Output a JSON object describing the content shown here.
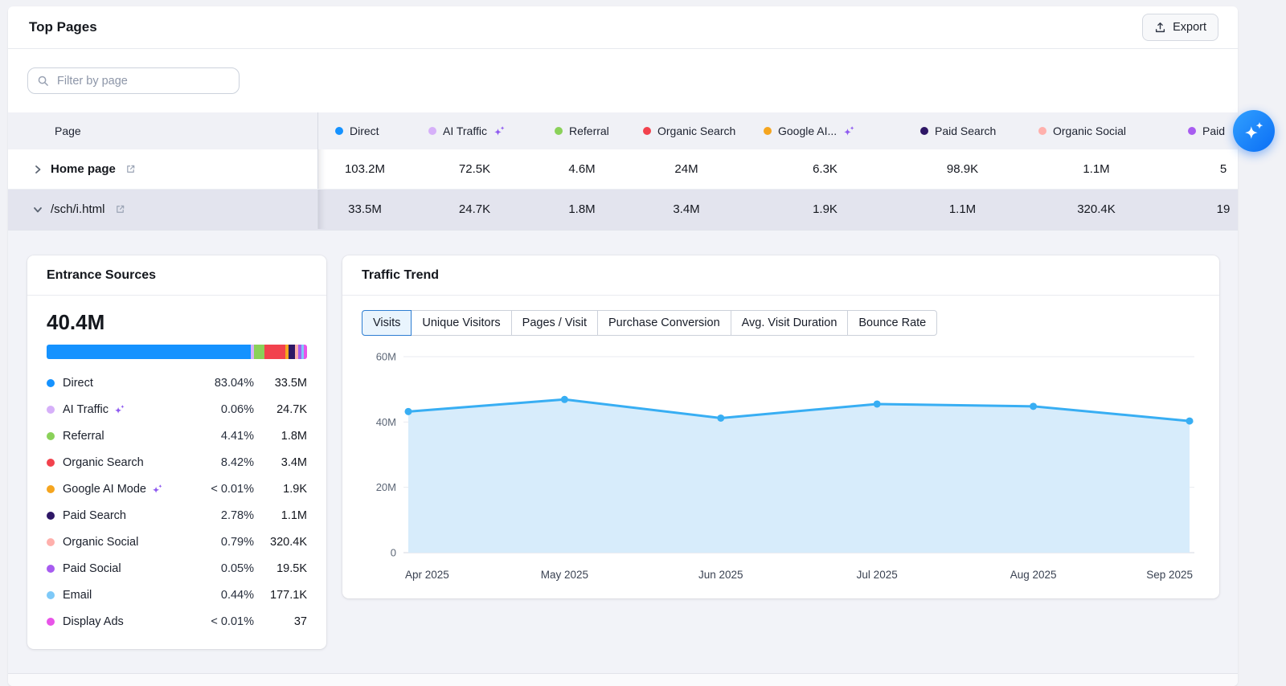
{
  "header": {
    "title": "Top Pages",
    "export_label": "Export"
  },
  "filter": {
    "placeholder": "Filter by page"
  },
  "table": {
    "page_column_header": "Page",
    "columns": [
      {
        "label": "Direct",
        "color": "#1592ff",
        "sparkle": false
      },
      {
        "label": "AI Traffic",
        "color": "#d6b0f9",
        "sparkle": true
      },
      {
        "label": "Referral",
        "color": "#8ad159",
        "sparkle": false
      },
      {
        "label": "Organic Search",
        "color": "#f2424d",
        "sparkle": false
      },
      {
        "label": "Google AI...",
        "color": "#f5a51f",
        "sparkle": true
      },
      {
        "label": "Paid Search",
        "color": "#2e1766",
        "sparkle": false
      },
      {
        "label": "Organic Social",
        "color": "#ffb0ac",
        "sparkle": false
      },
      {
        "label": "Paid",
        "color": "#a75cf0",
        "sparkle": false
      }
    ],
    "rows": [
      {
        "page": "Home page",
        "expanded": false,
        "selected": false,
        "emphasis": true,
        "values": [
          "103.2M",
          "72.5K",
          "4.6M",
          "24M",
          "6.3K",
          "98.9K",
          "1.1M",
          "5"
        ]
      },
      {
        "page": "/sch/i.html",
        "expanded": true,
        "selected": true,
        "emphasis": false,
        "values": [
          "33.5M",
          "24.7K",
          "1.8M",
          "3.4M",
          "1.9K",
          "1.1M",
          "320.4K",
          "19"
        ]
      }
    ]
  },
  "entrance_sources": {
    "title": "Entrance Sources",
    "total": "40.4M",
    "items": [
      {
        "label": "Direct",
        "color": "#1592ff",
        "percent": "83.04%",
        "value": "33.5M",
        "sparkle": false,
        "share": 83.04
      },
      {
        "label": "AI Traffic",
        "color": "#d6b0f9",
        "percent": "0.06%",
        "value": "24.7K",
        "sparkle": true,
        "share": 0.06
      },
      {
        "label": "Referral",
        "color": "#8ad159",
        "percent": "4.41%",
        "value": "1.8M",
        "sparkle": false,
        "share": 4.41
      },
      {
        "label": "Organic Search",
        "color": "#f2424d",
        "percent": "8.42%",
        "value": "3.4M",
        "sparkle": false,
        "share": 8.42
      },
      {
        "label": "Google AI Mode",
        "color": "#f5a51f",
        "percent": "< 0.01%",
        "value": "1.9K",
        "sparkle": true,
        "share": 0.01
      },
      {
        "label": "Paid Search",
        "color": "#2e1766",
        "percent": "2.78%",
        "value": "1.1M",
        "sparkle": false,
        "share": 2.78
      },
      {
        "label": "Organic Social",
        "color": "#ffb0ac",
        "percent": "0.79%",
        "value": "320.4K",
        "sparkle": false,
        "share": 0.79
      },
      {
        "label": "Paid Social",
        "color": "#a75cf0",
        "percent": "0.05%",
        "value": "19.5K",
        "sparkle": false,
        "share": 0.05
      },
      {
        "label": "Email",
        "color": "#7ec9f8",
        "percent": "0.44%",
        "value": "177.1K",
        "sparkle": false,
        "share": 0.44
      },
      {
        "label": "Display Ads",
        "color": "#e854e8",
        "percent": "< 0.01%",
        "value": "37",
        "sparkle": false,
        "share": 0.01
      }
    ]
  },
  "traffic_trend": {
    "title": "Traffic Trend",
    "tabs": [
      "Visits",
      "Unique Visitors",
      "Pages / Visit",
      "Purchase Conversion",
      "Avg. Visit Duration",
      "Bounce Rate"
    ],
    "active_tab": "Visits"
  },
  "chart_data": {
    "type": "area",
    "title": "Traffic Trend",
    "x": [
      "Apr 2025",
      "May 2025",
      "Jun 2025",
      "Jul 2025",
      "Aug 2025",
      "Sep 2025"
    ],
    "series": [
      {
        "name": "Visits",
        "values": [
          43200000,
          46900000,
          41200000,
          45500000,
          44800000,
          40300000
        ]
      }
    ],
    "y_ticks": [
      "0",
      "20M",
      "40M",
      "60M"
    ],
    "ylim": [
      0,
      60000000
    ],
    "xlabel": "",
    "ylabel": "",
    "grid": true,
    "legend_position": "none",
    "line_color": "#38aef3",
    "fill_color": "#d7ecfb"
  },
  "floating": {
    "ai_assistant_tooltip": "AI assistant"
  }
}
